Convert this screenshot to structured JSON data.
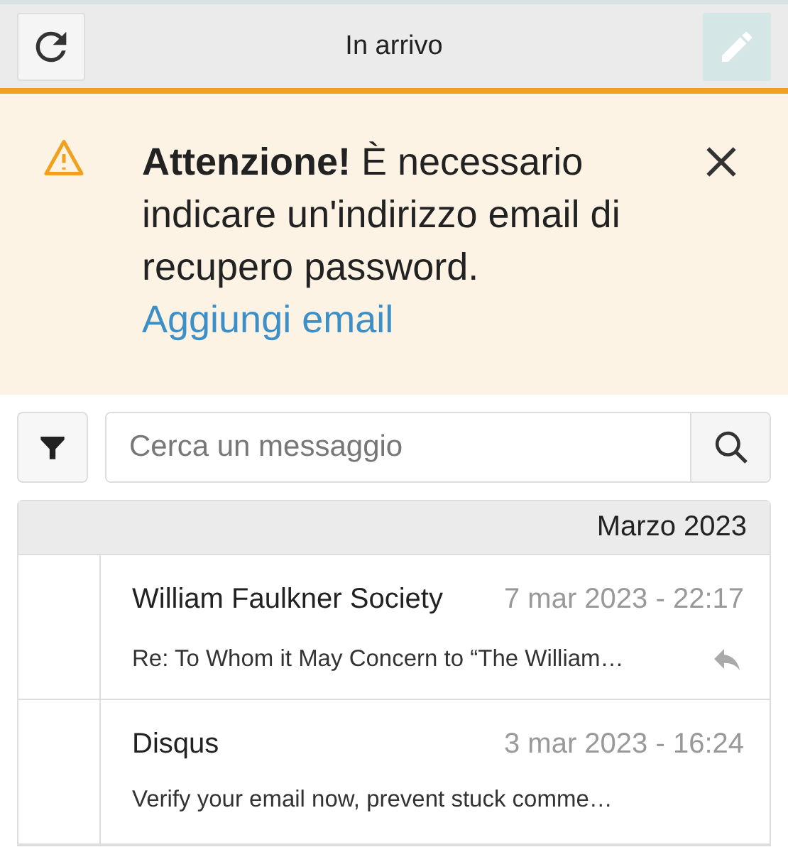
{
  "header": {
    "title": "In arrivo",
    "compose_disabled": true
  },
  "alert": {
    "title": "Attenzione!",
    "message": "È necessario indicare un'indirizzo email di recupero password.",
    "link": "Aggiungi email"
  },
  "search": {
    "placeholder": "Cerca un messaggio"
  },
  "groups": [
    {
      "label": "Marzo 2023",
      "messages": [
        {
          "sender": "William Faulkner Society",
          "date": "7 mar 2023 - 22:17",
          "subject": "Re: To Whom it May Concern to “The William…",
          "replied": true
        },
        {
          "sender": "Disqus",
          "date": "3 mar 2023 - 16:24",
          "subject": "Verify your email now, prevent stuck comme…",
          "replied": false
        }
      ]
    }
  ]
}
